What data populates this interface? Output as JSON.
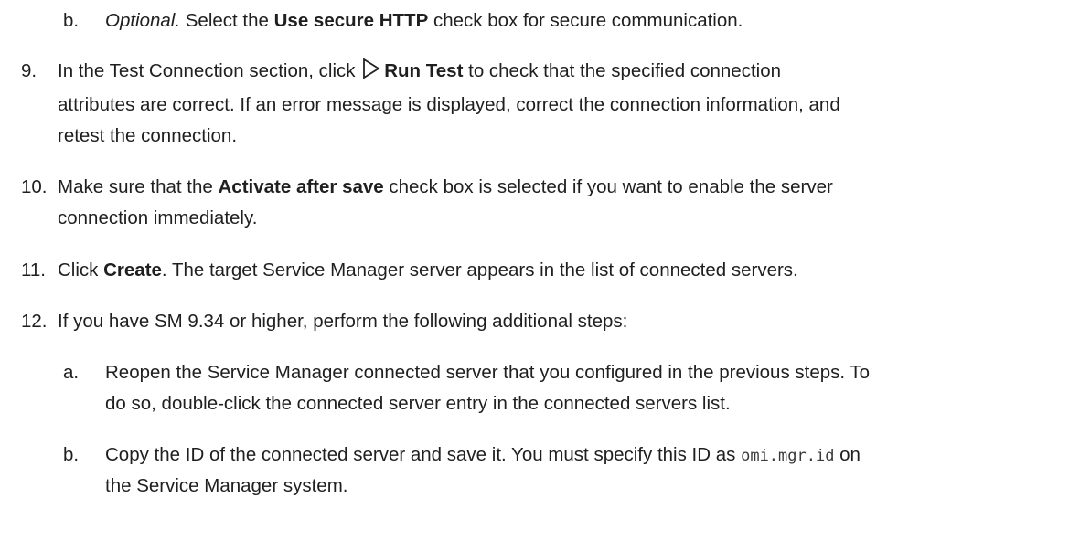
{
  "steps": {
    "s8b": {
      "marker": "b.",
      "optional": "Optional.",
      "t1": " Select the ",
      "bold": "Use secure HTTP",
      "t2": " check box for secure communication."
    },
    "s9": {
      "marker": "9.",
      "l1a": "In the Test Connection section, click",
      "run_test": "Run Test",
      "l1b": " to check that the specified connection",
      "l2": "attributes are correct. If an error message is displayed, correct the connection information, and",
      "l3": "retest the connection.",
      "icon": "play-triangle-icon"
    },
    "s10": {
      "marker": "10.",
      "t1": "Make sure that the ",
      "bold": "Activate after save",
      "t2": " check box is selected if you want to enable the server",
      "l2": "connection immediately."
    },
    "s11": {
      "marker": "11.",
      "t1": "Click ",
      "bold": "Create",
      "t2": ". The target Service Manager server appears in the list of connected servers."
    },
    "s12": {
      "marker": "12.",
      "text": "If you have SM 9.34 or higher, perform the following additional steps:"
    },
    "s12a": {
      "marker": "a.",
      "l1": "Reopen the Service Manager connected server that you configured in the previous steps. To",
      "l2": "do so, double-click the connected server entry in the connected servers list."
    },
    "s12b": {
      "marker": "b.",
      "l1a": "Copy the ID of the connected server and save it. You must specify this ID as ",
      "code": "omi.mgr.id",
      "l1b": " on",
      "l2": "the Service Manager system."
    }
  }
}
